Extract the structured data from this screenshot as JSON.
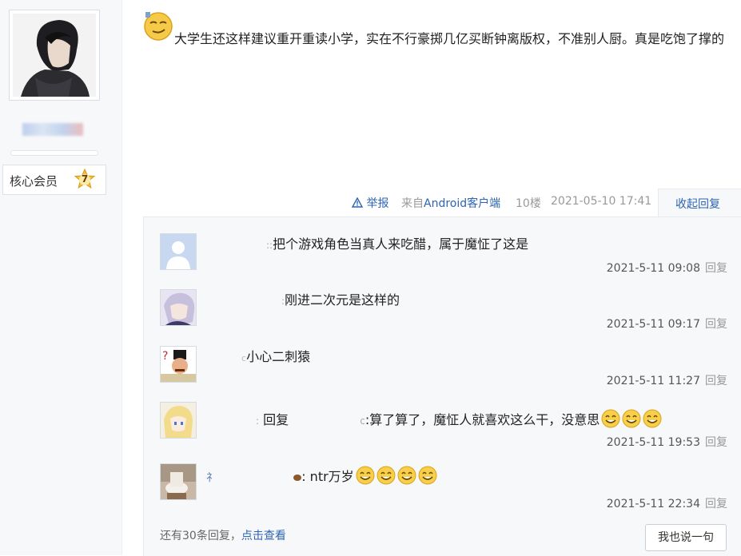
{
  "user": {
    "member_label": "核心会员",
    "level": "7"
  },
  "post": {
    "text": "大学生还这样建议重开重读小学，实在不行豪掷几亿买断钟离版权，不准别人厨。真是吃饱了撑的"
  },
  "meta": {
    "report": "举报",
    "source_prefix": "来自",
    "source_link": "Android客户端",
    "floor": "10楼",
    "time": "2021-05-10 17:41",
    "collapse": "收起回复"
  },
  "replies": [
    {
      "name_tail": "::",
      "text": "把个游戏角色当真人来吃醋，属于魔怔了这是",
      "time": "2021-5-11 09:08",
      "reply": "回复",
      "smiles": 0
    },
    {
      "name_tail": ":",
      "text": "刚进二次元是这样的",
      "time": "2021-5-11 09:17",
      "reply": "回复",
      "smiles": 0
    },
    {
      "name_tail": "c",
      "text": "小心二刺猿",
      "time": "2021-5-11 11:27",
      "reply": "回复",
      "smiles": 0
    },
    {
      "name_tail": ":",
      "reply_word": "回复",
      "target_tail": "c",
      "text": ":算了算了，魔怔人就喜欢这么干，没意思",
      "time": "2021-5-11 19:53",
      "reply": "回复",
      "smiles": 3
    },
    {
      "name_head": "礻",
      "name_tail": "",
      "text": ": ntr万岁",
      "time": "2021-5-11 22:34",
      "reply": "回复",
      "smiles": 4
    }
  ],
  "more": {
    "prefix": "还有30条回复，",
    "link": "点击查看"
  },
  "say_button": "我也说一句",
  "colors": {
    "link": "#2d64b3",
    "panel_bg": "#f7f8fa"
  }
}
